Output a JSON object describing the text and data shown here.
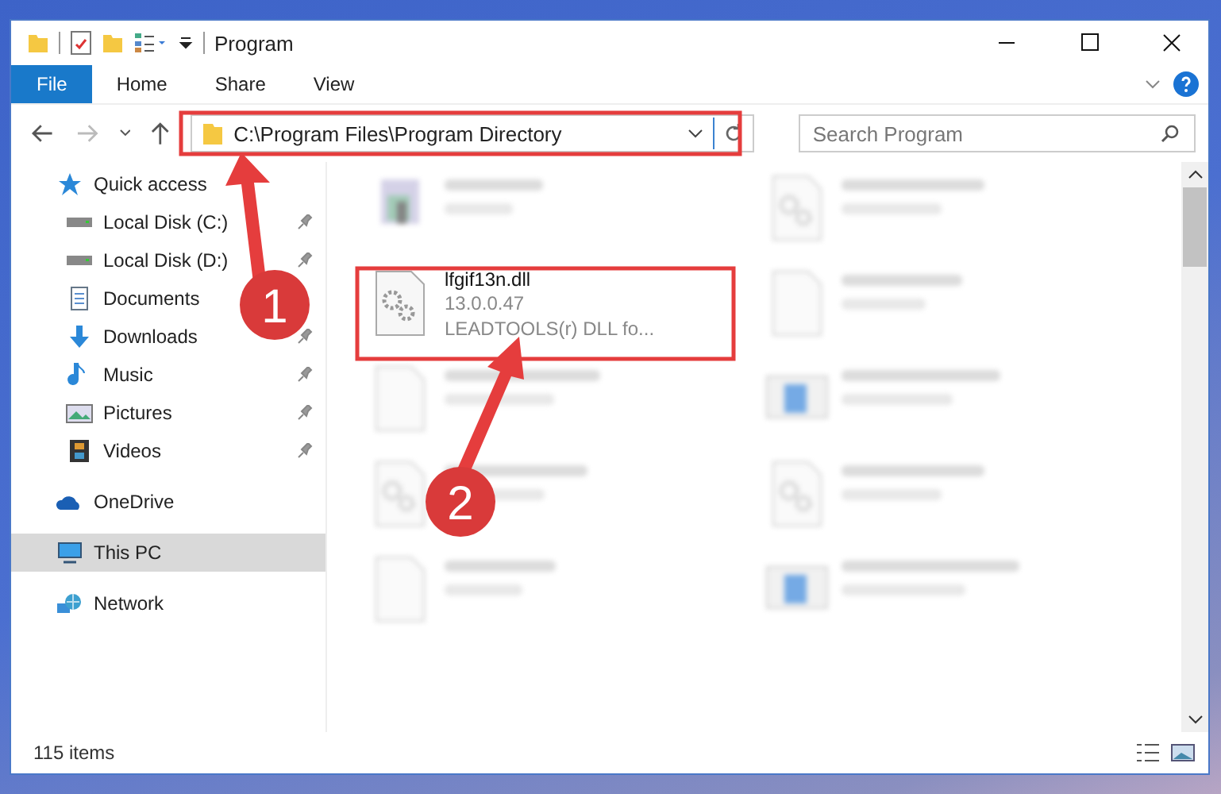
{
  "window": {
    "title": "Program"
  },
  "ribbon_tabs": [
    {
      "label": "File",
      "selected": true
    },
    {
      "label": "Home",
      "selected": false
    },
    {
      "label": "Share",
      "selected": false
    },
    {
      "label": "View",
      "selected": false
    }
  ],
  "address": {
    "path": "C:\\Program Files\\Program Directory"
  },
  "search": {
    "placeholder": "Search Program"
  },
  "sidebar": {
    "items": [
      {
        "label": "Quick access",
        "selected": false,
        "children": [
          {
            "label": "Local Disk (C:)",
            "pinned": true,
            "selected": false
          },
          {
            "label": "Local Disk (D:)",
            "pinned": true,
            "selected": false
          },
          {
            "label": "Documents",
            "pinned": false,
            "selected": false
          },
          {
            "label": "Downloads",
            "pinned": true,
            "selected": false
          },
          {
            "label": "Music",
            "pinned": true,
            "selected": false
          },
          {
            "label": "Pictures",
            "pinned": true,
            "selected": false
          },
          {
            "label": "Videos",
            "pinned": true,
            "selected": false
          }
        ]
      },
      {
        "label": "OneDrive",
        "selected": false
      },
      {
        "label": "This PC",
        "selected": true
      },
      {
        "label": "Network",
        "selected": false
      }
    ]
  },
  "files": [
    {
      "kind": "program",
      "blurred": true
    },
    {
      "kind": "gear",
      "blurred": true
    },
    {
      "name": "lfgif13n.dll",
      "lines": [
        "13.0.0.47",
        "LEADTOOLS(r) DLL fo..."
      ],
      "kind": "gear",
      "blurred": false
    },
    {
      "kind": "blank",
      "blurred": true
    },
    {
      "kind": "blank",
      "blurred": true
    },
    {
      "kind": "installer",
      "blurred": true
    },
    {
      "kind": "gear",
      "blurred": true
    },
    {
      "kind": "gear",
      "blurred": true
    },
    {
      "kind": "blank",
      "blurred": true
    },
    {
      "kind": "installer",
      "blurred": true
    }
  ],
  "status_bar": {
    "count": "115 items"
  },
  "annotations": [
    {
      "number": "1"
    },
    {
      "number": "2"
    }
  ]
}
